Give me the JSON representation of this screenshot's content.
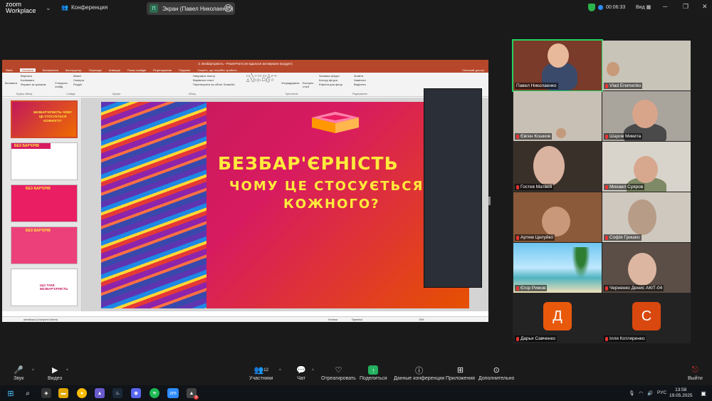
{
  "app": {
    "logo_line1": "zoom",
    "logo_line2": "Workplace",
    "meeting_label": "Конференция",
    "share_title": "Экран (Павел Николаенко)",
    "share_badge": "П",
    "timer": "00:06:33",
    "view_label": "Вид"
  },
  "presentation": {
    "window_title": "2. Безбар'єрність - PowerPoint (не вдалося активувати продукт)",
    "tabs": [
      "Файл",
      "Основне",
      "Вставлення",
      "Конструктор",
      "Переходи",
      "Анімація",
      "Показ слайдів",
      "Рецензування",
      "Подання"
    ],
    "search_hint": "Скажіть, що потрібно зробити...",
    "share_btn": "Спільний доступ",
    "ribbon": {
      "paste": "Вставити",
      "cut": "Вирізати",
      "copy": "Копіювати",
      "format": "Формат за зразком",
      "clipboard": "Буфер обміну",
      "new_slide": "Створити слайд",
      "layout": "Макет",
      "reset": "Скинути",
      "section": "Розділ",
      "slides": "Слайди",
      "font": "Шрифт",
      "paragraph": "Абзац",
      "text_dir": "Напрямок тексту",
      "align_text": "Вирівняти текст",
      "smartart": "Перетворити на об'єкт SmartArt",
      "drawing": "Креслення",
      "arrange": "Упорядкувати",
      "quick_styles": "Експрес-стилі",
      "fill": "Заливка фігури",
      "outline": "Контур фігури",
      "effects": "Ефекти для фігур",
      "find": "Знайти",
      "replace": "Замінити",
      "select": "Виділити",
      "editing": "Редагування"
    },
    "thumbnails": [
      {
        "num": "1",
        "title": "БЕЗБАР'ЄРНІСТЬ ЧОМУ ЦЕ СТОСУЄТЬСЯ КОЖНОГО?"
      },
      {
        "num": "2",
        "title": "БЕЗ БАР'ЄРІВ"
      },
      {
        "num": "3",
        "title": "БЕЗ БАР'ЄРІВ"
      },
      {
        "num": "4",
        "title": "БЕЗ БАР'ЄРІВ"
      },
      {
        "num": "5",
        "title": "ЩО ТАКЕ БЕЗБАР'ЄРНІСТЬ"
      }
    ],
    "slide": {
      "line1": "БЕЗБАР'ЄРНІСТЬ",
      "line2": "ЧОМУ ЦЕ СТОСУЄТЬСЯ",
      "line3": "КОЖНОГО?"
    },
    "status": {
      "lang": "англійська (Сполучені Штати)",
      "notes": "Нотатки",
      "comments": "Примітки",
      "zoom": "53%"
    }
  },
  "participants": [
    {
      "name": "Павел Николаенко",
      "muted": false,
      "active": true
    },
    {
      "name": "Vlad Eremenko",
      "muted": true,
      "active": false
    },
    {
      "name": "Євген Кошков",
      "muted": true,
      "active": false
    },
    {
      "name": "Шаров Микита",
      "muted": true,
      "active": false
    },
    {
      "name": "Гостев Матвей",
      "muted": true,
      "active": false
    },
    {
      "name": "Михаил Суяров",
      "muted": true,
      "active": false
    },
    {
      "name": "Артем Целуйко",
      "muted": true,
      "active": false
    },
    {
      "name": "Софія Гришко",
      "muted": true,
      "active": false
    },
    {
      "name": "Єгор Рижов",
      "muted": true,
      "active": false
    },
    {
      "name": "Черненко Денис АКІТ-04",
      "muted": true,
      "active": false
    },
    {
      "name": "Дарья Савченко",
      "muted": true,
      "active": false,
      "initial": "Д"
    },
    {
      "name": "Ілля Котляренко",
      "muted": true,
      "active": false,
      "initial": "С"
    }
  ],
  "controls": {
    "audio": "Звук",
    "video": "Видео",
    "participants": "Участники",
    "participants_count": "12",
    "chat": "Чат",
    "react": "Отреагировать",
    "share": "Поделиться",
    "meeting_data": "Данные конференции",
    "apps": "Приложения",
    "more": "Дополнительно",
    "leave": "Выйти"
  },
  "taskbar": {
    "lang": "РУС",
    "time": "13:58",
    "date": "19.05.2025",
    "notif_count": "8"
  },
  "colors": {
    "ppt_red": "#b7472a",
    "zoom_blue": "#2d8cff",
    "active_green": "#23d160",
    "avatar_orange": "#e8590c",
    "avatar_red": "#d9480f"
  }
}
